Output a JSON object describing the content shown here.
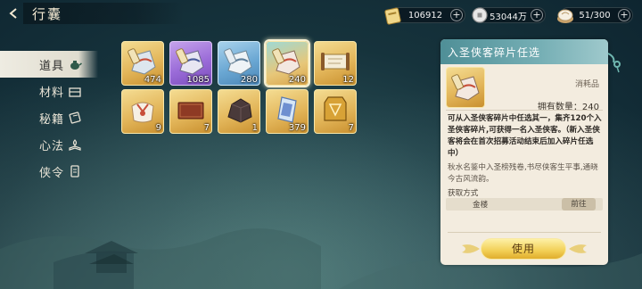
{
  "header": {
    "title": "行囊"
  },
  "resources": [
    {
      "icon": "banknote-icon",
      "value": "106912"
    },
    {
      "icon": "silver-coin-icon",
      "value": "53044万"
    },
    {
      "icon": "steamed-bun-icon",
      "value": "51/300"
    }
  ],
  "nav": [
    {
      "label": "道具",
      "icon": "teapot-icon",
      "active": true
    },
    {
      "label": "材料",
      "icon": "chest-icon",
      "active": false
    },
    {
      "label": "秘籍",
      "icon": "scroll-icon",
      "active": false
    },
    {
      "label": "心法",
      "icon": "lotus-book-icon",
      "active": false
    },
    {
      "label": "侠令",
      "icon": "token-icon",
      "active": false
    }
  ],
  "items": [
    {
      "icon": "fragment-bag-icon",
      "rarity": "gold",
      "count": "474"
    },
    {
      "icon": "fragment-bag-icon",
      "rarity": "purple",
      "count": "1085"
    },
    {
      "icon": "fragment-bag-icon",
      "rarity": "blue",
      "count": "280"
    },
    {
      "icon": "fragment-bag-icon",
      "rarity": "gold",
      "count": "240",
      "selected": true
    },
    {
      "icon": "scroll-icon",
      "rarity": "gold",
      "count": "12"
    },
    {
      "icon": "gift-pouch-icon",
      "rarity": "gold",
      "count": "9"
    },
    {
      "icon": "red-book-icon",
      "rarity": "gold",
      "count": "7"
    },
    {
      "icon": "ore-icon",
      "rarity": "gold",
      "count": "1"
    },
    {
      "icon": "jade-plate-icon",
      "rarity": "gold",
      "count": "379"
    },
    {
      "icon": "gold-token-icon",
      "rarity": "gold",
      "count": "7"
    }
  ],
  "detail": {
    "title": "入圣侠客碎片任选",
    "type": "消耗品",
    "owned": "拥有数量：240",
    "description": "可从入圣侠客碎片中任选其一，集齐120个入圣侠客碎片,可获得一名入圣侠客。（新入圣侠客将会在首次招募活动结束后加入碎片任选中）",
    "flavor": "秋水名鉴中入圣榜残卷,书尽侠客生平事,通晓今古风流韵。",
    "source_label": "获取方式",
    "source_name": "金楼",
    "goto_label": "前往",
    "use_label": "使用"
  },
  "colors": {
    "gold_slot": "#e3b65a",
    "purple_slot": "#9a6bd8",
    "blue_slot": "#6aa7d3",
    "panel_header": "#5f9ba2",
    "use_button": "#f2cf55"
  }
}
